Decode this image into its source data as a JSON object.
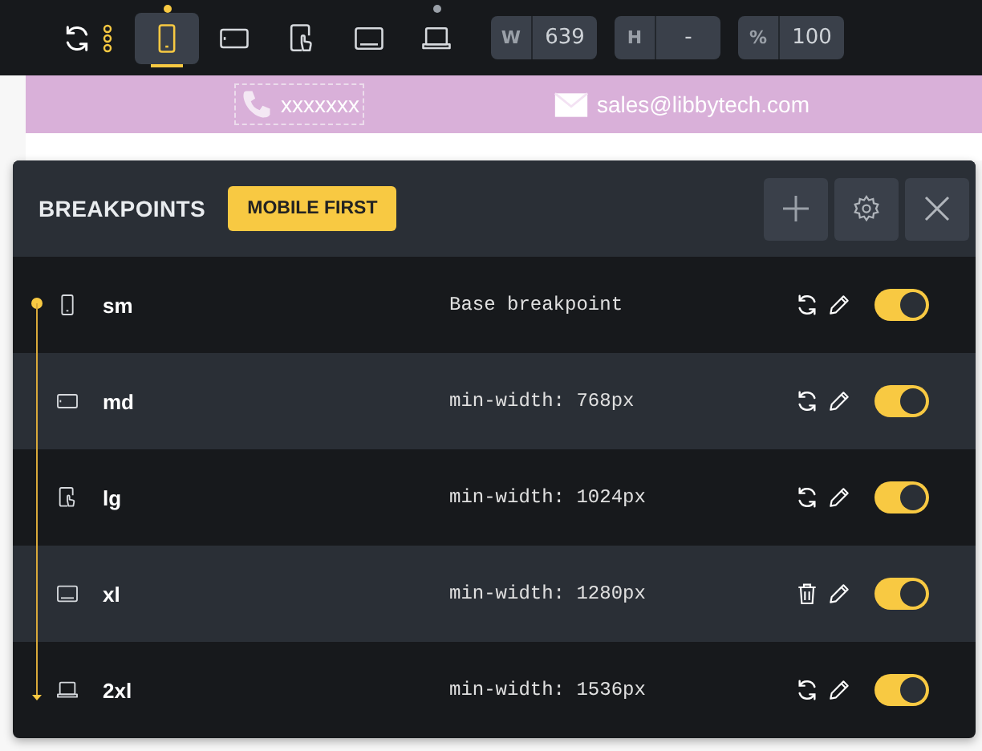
{
  "toolbar": {
    "devices": [
      {
        "kind": "phone",
        "selected": true,
        "dot": true
      },
      {
        "kind": "tablet",
        "selected": false,
        "dot": false
      },
      {
        "kind": "touch",
        "selected": false,
        "dot": false
      },
      {
        "kind": "monitor",
        "selected": false,
        "dot": false
      },
      {
        "kind": "laptop",
        "selected": false,
        "dot": true
      }
    ],
    "fields": [
      {
        "label": "W",
        "value": "639"
      },
      {
        "label": "H",
        "value": "-"
      },
      {
        "label": "%",
        "value": "100"
      }
    ]
  },
  "banner": {
    "phone": "xxxxxxx",
    "email": "sales@libbytech.com"
  },
  "panel": {
    "title": "BREAKPOINTS",
    "mode": "MOBILE FIRST",
    "breakpoints": [
      {
        "kind": "phone",
        "name": "sm",
        "rule": "Base breakpoint",
        "actions": [
          {
            "kind": "reset"
          },
          {
            "kind": "edit"
          }
        ],
        "on": true
      },
      {
        "kind": "tablet",
        "name": "md",
        "rule": "min-width: 768px",
        "actions": [
          {
            "kind": "reset"
          },
          {
            "kind": "edit"
          }
        ],
        "on": true
      },
      {
        "kind": "touch",
        "name": "lg",
        "rule": "min-width: 1024px",
        "actions": [
          {
            "kind": "reset"
          },
          {
            "kind": "edit"
          }
        ],
        "on": true
      },
      {
        "kind": "monitor",
        "name": "xl",
        "rule": "min-width: 1280px",
        "actions": [
          {
            "kind": "delete"
          },
          {
            "kind": "edit"
          }
        ],
        "on": true
      },
      {
        "kind": "laptop",
        "name": "2xl",
        "rule": "min-width: 1536px",
        "actions": [
          {
            "kind": "reset"
          },
          {
            "kind": "edit"
          }
        ],
        "on": true
      }
    ]
  }
}
